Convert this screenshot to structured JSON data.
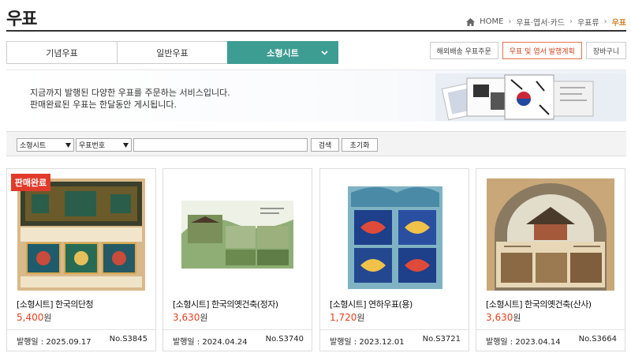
{
  "header": {
    "title": "우표",
    "breadcrumb": [
      "HOME",
      "우표·엽서·카드",
      "우표류",
      "우표"
    ]
  },
  "tabs": [
    {
      "label": "기념우표",
      "active": false
    },
    {
      "label": "일반우표",
      "active": false
    },
    {
      "label": "소형시트",
      "active": true
    }
  ],
  "right_buttons": [
    "해외배송 우표주문",
    "우표 및 엽서 발행계획",
    "장바구니"
  ],
  "banner": {
    "line1": "지금까지 발행된 다양한 우표를 주문하는 서비스입니다.",
    "line2": "판매완료된 우표는 한달동안 게시됩니다."
  },
  "search": {
    "category_value": "소형시트",
    "field_value": "우표번호",
    "query": "",
    "search_label": "검색",
    "reset_label": "초기화"
  },
  "colors": {
    "accent": "#3e9d93",
    "price": "#e53f1e",
    "sold_badge": "#e23a2a"
  },
  "products": [
    {
      "name": "[소형시트] 한국의단청",
      "price": "5,400",
      "won": "원",
      "date_label": "발행일 : 2025.09.17",
      "no": "No.S3845",
      "sold_out": "판매완료"
    },
    {
      "name": "[소형시트] 한국의옛건축(정자)",
      "price": "3,630",
      "won": "원",
      "date_label": "발행일 : 2024.04.24",
      "no": "No.S3740",
      "sold_out": ""
    },
    {
      "name": "[소형시트] 연하우표(용)",
      "price": "1,720",
      "won": "원",
      "date_label": "발행일 : 2023.12.01",
      "no": "No.S3721",
      "sold_out": ""
    },
    {
      "name": "[소형시트] 한국의옛건축(산사)",
      "price": "3,630",
      "won": "원",
      "date_label": "발행일 : 2023.04.14",
      "no": "No.S3664",
      "sold_out": ""
    }
  ]
}
